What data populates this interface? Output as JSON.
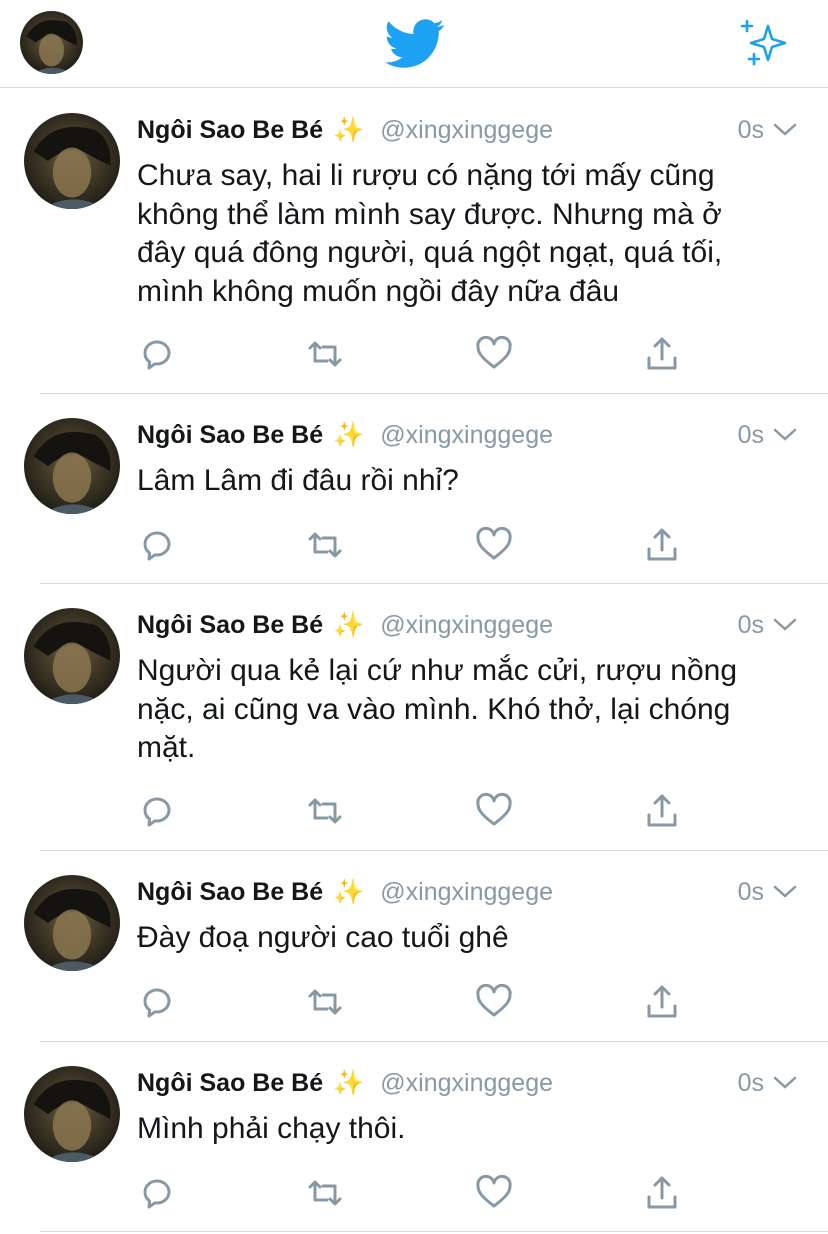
{
  "colors": {
    "accent": "#1da1f2",
    "muted": "#8899a6",
    "icon": "#8899a6",
    "divider": "#d8dde2"
  },
  "topbar": {
    "logo_icon": "twitter-bird-icon",
    "sparkle_icon": "sparkle-icon"
  },
  "tweets": [
    {
      "name": "Ngôi Sao Be Bé",
      "emoji": "✨",
      "handle": "@xingxinggege",
      "time": "0s",
      "lines": [
        "Chưa say, hai li rượu có nặng tới mấy cũng",
        "không thể làm mình say được. Nhưng mà ở",
        "đây quá đông người, quá ngột ngạt, quá tối,",
        "mình không muốn ngồi đây nữa đâu"
      ]
    },
    {
      "name": "Ngôi Sao Be Bé",
      "emoji": "✨",
      "handle": "@xingxinggege",
      "time": "0s",
      "lines": [
        "Lâm Lâm đi đâu rồi nhỉ?"
      ]
    },
    {
      "name": "Ngôi Sao Be Bé",
      "emoji": "✨",
      "handle": "@xingxinggege",
      "time": "0s",
      "lines": [
        "Người qua kẻ lại cứ như mắc cửi, rượu nồng",
        "nặc, ai cũng va vào mình. Khó thở, lại chóng",
        "mặt."
      ]
    },
    {
      "name": "Ngôi Sao Be Bé",
      "emoji": "✨",
      "handle": "@xingxinggege",
      "time": "0s",
      "lines": [
        "Đày đoạ người cao tuổi ghê"
      ]
    },
    {
      "name": "Ngôi Sao Be Bé",
      "emoji": "✨",
      "handle": "@xingxinggege",
      "time": "0s",
      "lines": [
        "Mình phải chạy thôi."
      ]
    }
  ]
}
